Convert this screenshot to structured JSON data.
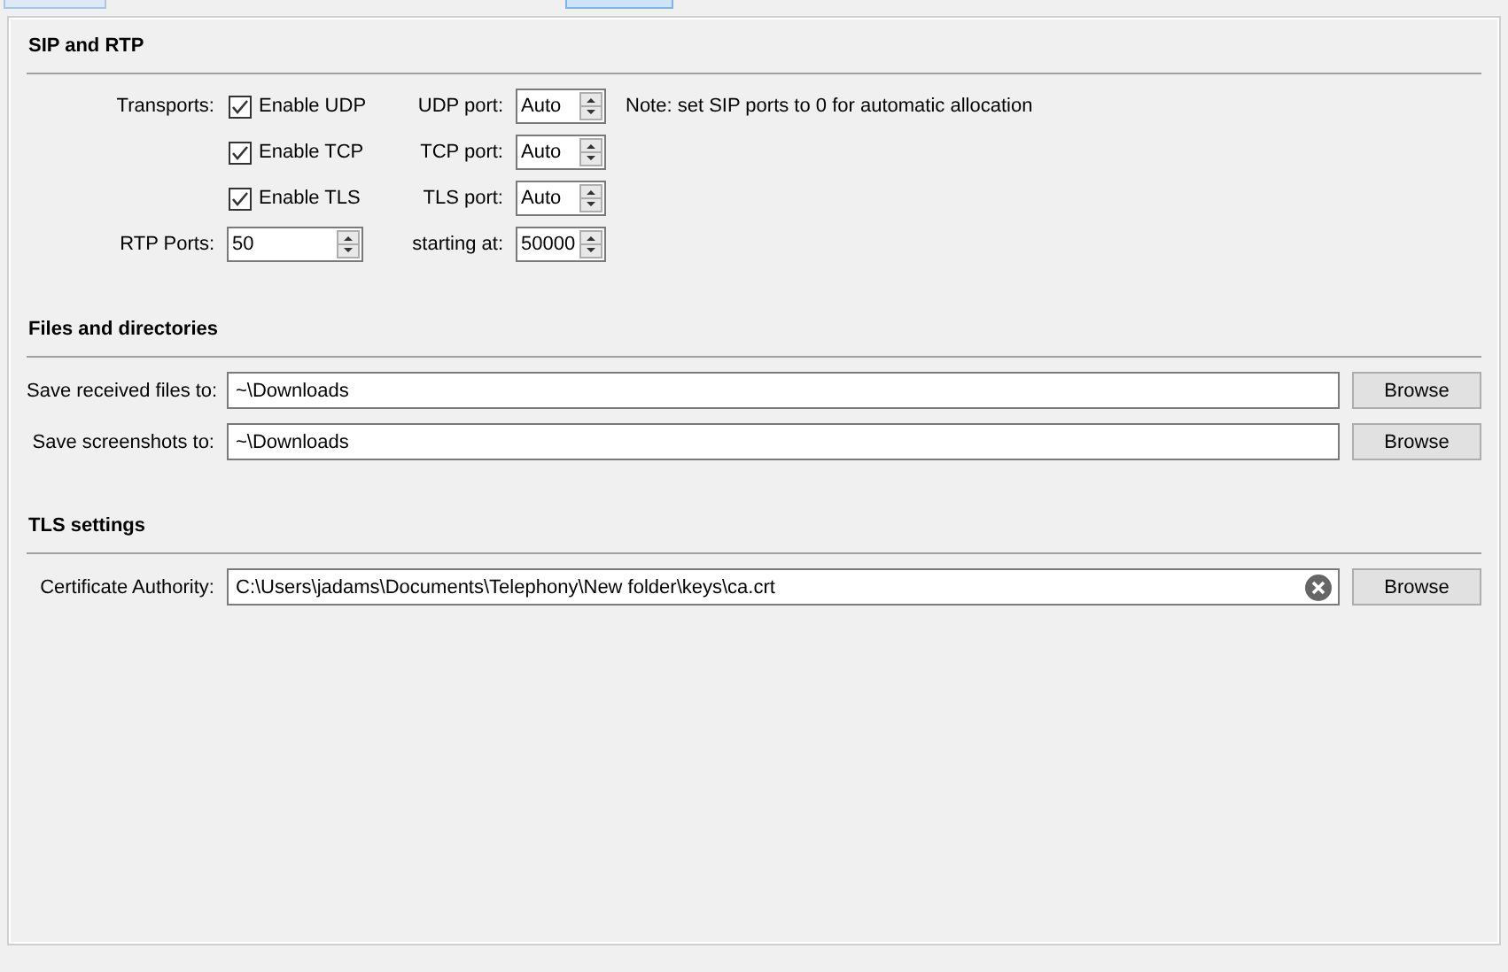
{
  "tabs": [
    {
      "selected": false
    },
    {
      "selected": true
    }
  ],
  "sip_rtp": {
    "title": "SIP and RTP",
    "transports_label": "Transports:",
    "transports": [
      {
        "label": "Enable UDP",
        "checked": true,
        "port_label": "UDP port:",
        "port_value": "Auto"
      },
      {
        "label": "Enable TCP",
        "checked": true,
        "port_label": "TCP port:",
        "port_value": "Auto"
      },
      {
        "label": "Enable TLS",
        "checked": true,
        "port_label": "TLS port:",
        "port_value": "Auto"
      }
    ],
    "note": "Note: set SIP ports to 0 for automatic allocation",
    "rtp_ports": {
      "label": "RTP Ports:",
      "value": "50"
    },
    "starting_at": {
      "label": "starting at:",
      "value": "50000"
    }
  },
  "sections": [
    {
      "title": "Files and directories",
      "rows": [
        {
          "label": "Save received files to:",
          "value": "~\\Downloads",
          "clear_button": false,
          "button": "Browse"
        },
        {
          "label": "Save screenshots to:",
          "value": "~\\Downloads",
          "clear_button": false,
          "button": "Browse"
        }
      ]
    },
    {
      "title": "TLS settings",
      "rows": [
        {
          "label": "Certificate Authority:",
          "value": "C:\\Users\\jadams\\Documents\\Telephony\\New folder\\keys\\ca.crt",
          "clear_button": true,
          "button": "Browse"
        }
      ]
    }
  ]
}
